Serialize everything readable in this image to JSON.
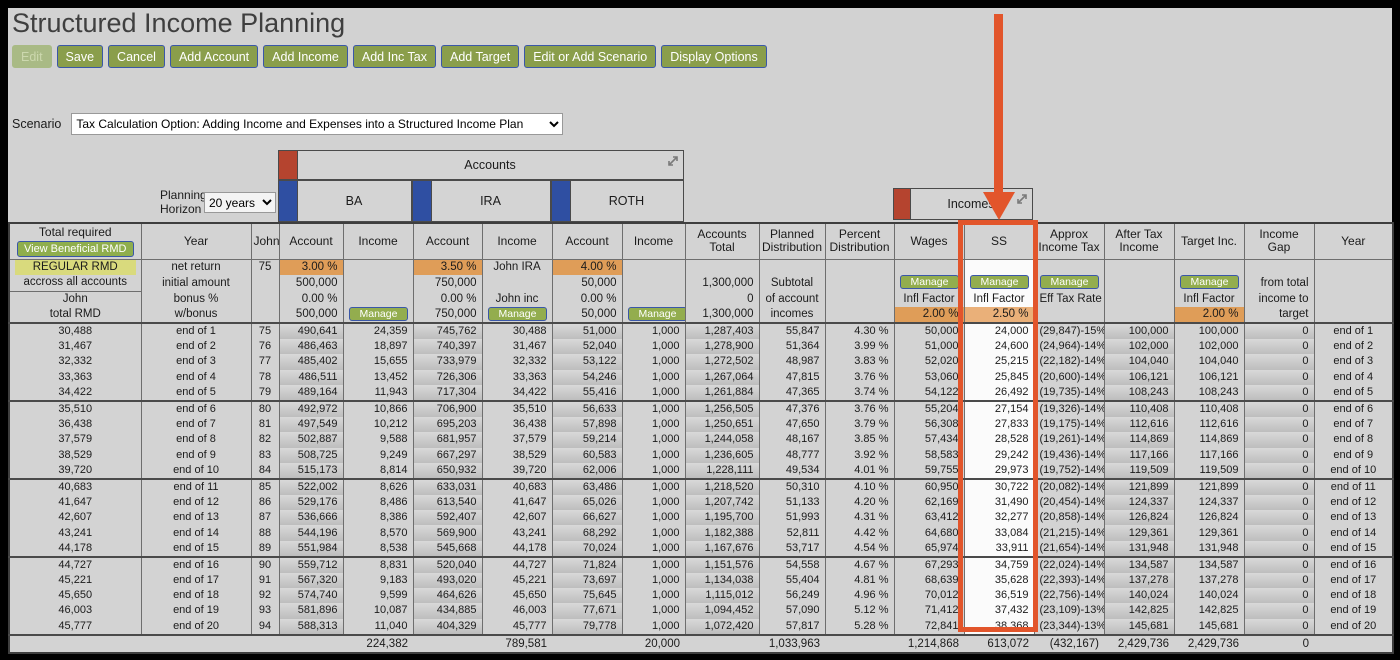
{
  "page": {
    "title": "Structured Income Planning"
  },
  "toolbar": {
    "buttons": [
      {
        "label": "Edit",
        "disabled": true
      },
      {
        "label": "Save",
        "disabled": false
      },
      {
        "label": "Cancel",
        "disabled": false
      },
      {
        "label": "Add Account",
        "disabled": false
      },
      {
        "label": "Add Income",
        "disabled": false
      },
      {
        "label": "Add Inc Tax",
        "disabled": false
      },
      {
        "label": "Add Target",
        "disabled": false
      },
      {
        "label": "Edit or Add Scenario",
        "disabled": false
      },
      {
        "label": "Display Options",
        "disabled": false
      }
    ]
  },
  "scenario": {
    "label": "Scenario",
    "value": "Tax Calculation Option: Adding Income and Expenses into a Structured Income Plan"
  },
  "planning_horizon": {
    "label_line1": "Planning",
    "label_line2": "Horizon",
    "value": "20 years"
  },
  "groups": {
    "accounts": "Accounts",
    "incomes": "Incomes",
    "ba": "BA",
    "ira": "IRA",
    "roth": "ROTH"
  },
  "columns": {
    "total_required": "Total required",
    "view_rmd_button": "View Beneficial RMD",
    "year": "Year",
    "john": "John",
    "account": "Account",
    "income": "Income",
    "accounts_total": "Accounts Total",
    "planned_distribution": "Planned Distribution",
    "percent_distribution": "Percent Distribution",
    "wages": "Wages",
    "ss": "SS",
    "approx_income_tax": "Approx Income Tax",
    "after_tax_income": "After Tax Income",
    "target_inc": "Target Inc.",
    "income_gap": "Income Gap",
    "year_right": "Year"
  },
  "left_blocks": {
    "regular_rmd": "REGULAR RMD",
    "across_all": "accross all accounts",
    "john": "John",
    "total_rmd": "total RMD"
  },
  "subheader": {
    "row_labels": [
      "net return",
      "initial amount",
      "bonus %",
      "w/bonus"
    ],
    "manage_label": "Manage",
    "net_return": {
      "john": "75",
      "ba": "3.00 %",
      "ira": "3.50 %",
      "ira_income_name": "John IRA",
      "roth": "4.00 %"
    },
    "initial": {
      "ba": "500,000",
      "ira": "750,000",
      "roth": "50,000",
      "accounts_total": "1,300,000",
      "planned": "Subtotal",
      "gap": "from total"
    },
    "bonus": {
      "ba": "0.00 %",
      "ira": "0.00 %",
      "ira_income_name": "John inc",
      "roth": "0.00 %",
      "accounts_total": "0",
      "planned": "of account",
      "wages": "Infl Factor",
      "ss": "Infl Factor",
      "tax": "Eff Tax Rate",
      "target": "Infl Factor",
      "gap": "income to"
    },
    "wbonus": {
      "ba": "500,000",
      "ira": "750,000",
      "roth": "50,000",
      "accounts_total": "1,300,000",
      "planned": "incomes",
      "wages": "2.00 %",
      "ss": "2.50 %",
      "target": "2.00 %",
      "gap": "target"
    }
  },
  "table": {
    "rows": [
      [
        "30,488",
        "end of 1",
        "75",
        "490,641",
        "24,359",
        "745,762",
        "30,488",
        "51,000",
        "1,000",
        "1,287,403",
        "55,847",
        "4.30 %",
        "50,000",
        "24,000",
        "(29,847)-15%",
        "100,000",
        "100,000",
        "0",
        "end of 1"
      ],
      [
        "31,467",
        "end of 2",
        "76",
        "486,463",
        "18,897",
        "740,397",
        "31,467",
        "52,040",
        "1,000",
        "1,278,900",
        "51,364",
        "3.99 %",
        "51,000",
        "24,600",
        "(24,964)-14%",
        "102,000",
        "102,000",
        "0",
        "end of 2"
      ],
      [
        "32,332",
        "end of 3",
        "77",
        "485,402",
        "15,655",
        "733,979",
        "32,332",
        "53,122",
        "1,000",
        "1,272,502",
        "48,987",
        "3.83 %",
        "52,020",
        "25,215",
        "(22,182)-14%",
        "104,040",
        "104,040",
        "0",
        "end of 3"
      ],
      [
        "33,363",
        "end of 4",
        "78",
        "486,511",
        "13,452",
        "726,306",
        "33,363",
        "54,246",
        "1,000",
        "1,267,064",
        "47,815",
        "3.76 %",
        "53,060",
        "25,845",
        "(20,600)-14%",
        "106,121",
        "106,121",
        "0",
        "end of 4"
      ],
      [
        "34,422",
        "end of 5",
        "79",
        "489,164",
        "11,943",
        "717,304",
        "34,422",
        "55,416",
        "1,000",
        "1,261,884",
        "47,365",
        "3.74 %",
        "54,122",
        "26,492",
        "(19,735)-14%",
        "108,243",
        "108,243",
        "0",
        "end of 5"
      ],
      [
        "35,510",
        "end of 6",
        "80",
        "492,972",
        "10,866",
        "706,900",
        "35,510",
        "56,633",
        "1,000",
        "1,256,505",
        "47,376",
        "3.76 %",
        "55,204",
        "27,154",
        "(19,326)-14%",
        "110,408",
        "110,408",
        "0",
        "end of 6"
      ],
      [
        "36,438",
        "end of 7",
        "81",
        "497,549",
        "10,212",
        "695,203",
        "36,438",
        "57,898",
        "1,000",
        "1,250,651",
        "47,650",
        "3.79 %",
        "56,308",
        "27,833",
        "(19,175)-14%",
        "112,616",
        "112,616",
        "0",
        "end of 7"
      ],
      [
        "37,579",
        "end of 8",
        "82",
        "502,887",
        "9,588",
        "681,957",
        "37,579",
        "59,214",
        "1,000",
        "1,244,058",
        "48,167",
        "3.85 %",
        "57,434",
        "28,528",
        "(19,261)-14%",
        "114,869",
        "114,869",
        "0",
        "end of 8"
      ],
      [
        "38,529",
        "end of 9",
        "83",
        "508,725",
        "9,249",
        "667,297",
        "38,529",
        "60,583",
        "1,000",
        "1,236,605",
        "48,777",
        "3.92 %",
        "58,583",
        "29,242",
        "(19,436)-14%",
        "117,166",
        "117,166",
        "0",
        "end of 9"
      ],
      [
        "39,720",
        "end of 10",
        "84",
        "515,173",
        "8,814",
        "650,932",
        "39,720",
        "62,006",
        "1,000",
        "1,228,111",
        "49,534",
        "4.01 %",
        "59,755",
        "29,973",
        "(19,752)-14%",
        "119,509",
        "119,509",
        "0",
        "end of 10"
      ],
      [
        "40,683",
        "end of 11",
        "85",
        "522,002",
        "8,626",
        "633,031",
        "40,683",
        "63,486",
        "1,000",
        "1,218,520",
        "50,310",
        "4.10 %",
        "60,950",
        "30,722",
        "(20,082)-14%",
        "121,899",
        "121,899",
        "0",
        "end of 11"
      ],
      [
        "41,647",
        "end of 12",
        "86",
        "529,176",
        "8,486",
        "613,540",
        "41,647",
        "65,026",
        "1,000",
        "1,207,742",
        "51,133",
        "4.20 %",
        "62,169",
        "31,490",
        "(20,454)-14%",
        "124,337",
        "124,337",
        "0",
        "end of 12"
      ],
      [
        "42,607",
        "end of 13",
        "87",
        "536,666",
        "8,386",
        "592,407",
        "42,607",
        "66,627",
        "1,000",
        "1,195,700",
        "51,993",
        "4.31 %",
        "63,412",
        "32,277",
        "(20,858)-14%",
        "126,824",
        "126,824",
        "0",
        "end of 13"
      ],
      [
        "43,241",
        "end of 14",
        "88",
        "544,196",
        "8,570",
        "569,900",
        "43,241",
        "68,292",
        "1,000",
        "1,182,388",
        "52,811",
        "4.42 %",
        "64,680",
        "33,084",
        "(21,215)-14%",
        "129,361",
        "129,361",
        "0",
        "end of 14"
      ],
      [
        "44,178",
        "end of 15",
        "89",
        "551,984",
        "8,538",
        "545,668",
        "44,178",
        "70,024",
        "1,000",
        "1,167,676",
        "53,717",
        "4.54 %",
        "65,974",
        "33,911",
        "(21,654)-14%",
        "131,948",
        "131,948",
        "0",
        "end of 15"
      ],
      [
        "44,727",
        "end of 16",
        "90",
        "559,712",
        "8,831",
        "520,040",
        "44,727",
        "71,824",
        "1,000",
        "1,151,576",
        "54,558",
        "4.67 %",
        "67,293",
        "34,759",
        "(22,024)-14%",
        "134,587",
        "134,587",
        "0",
        "end of 16"
      ],
      [
        "45,221",
        "end of 17",
        "91",
        "567,320",
        "9,183",
        "493,020",
        "45,221",
        "73,697",
        "1,000",
        "1,134,038",
        "55,404",
        "4.81 %",
        "68,639",
        "35,628",
        "(22,393)-14%",
        "137,278",
        "137,278",
        "0",
        "end of 17"
      ],
      [
        "45,650",
        "end of 18",
        "92",
        "574,740",
        "9,599",
        "464,626",
        "45,650",
        "75,645",
        "1,000",
        "1,115,012",
        "56,249",
        "4.96 %",
        "70,012",
        "36,519",
        "(22,756)-14%",
        "140,024",
        "140,024",
        "0",
        "end of 18"
      ],
      [
        "46,003",
        "end of 19",
        "93",
        "581,896",
        "10,087",
        "434,885",
        "46,003",
        "77,671",
        "1,000",
        "1,094,452",
        "57,090",
        "5.12 %",
        "71,412",
        "37,432",
        "(23,109)-13%",
        "142,825",
        "142,825",
        "0",
        "end of 19"
      ],
      [
        "45,777",
        "end of 20",
        "94",
        "588,313",
        "11,040",
        "404,329",
        "45,777",
        "79,778",
        "1,000",
        "1,072,420",
        "57,817",
        "5.28 %",
        "72,841",
        "38,368",
        "(23,344)-13%",
        "145,681",
        "145,681",
        "0",
        "end of 20"
      ]
    ],
    "totals": [
      "",
      "",
      "",
      "",
      "224,382",
      "",
      "789,581",
      "",
      "20,000",
      "",
      "1,033,963",
      "",
      "1,214,868",
      "613,072",
      "(432,167)",
      "2,429,736",
      "2,429,736",
      "0",
      ""
    ]
  },
  "colors": {
    "accent_arrow": "#e2552b",
    "button_green": "#8a9e4b",
    "manage_green": "#93ad4e",
    "orange_cell": "#df9d58",
    "yellow_highlight": "#d9da7d",
    "group_block_red": "#b5442f",
    "group_block_blue": "#2f4fa2"
  }
}
